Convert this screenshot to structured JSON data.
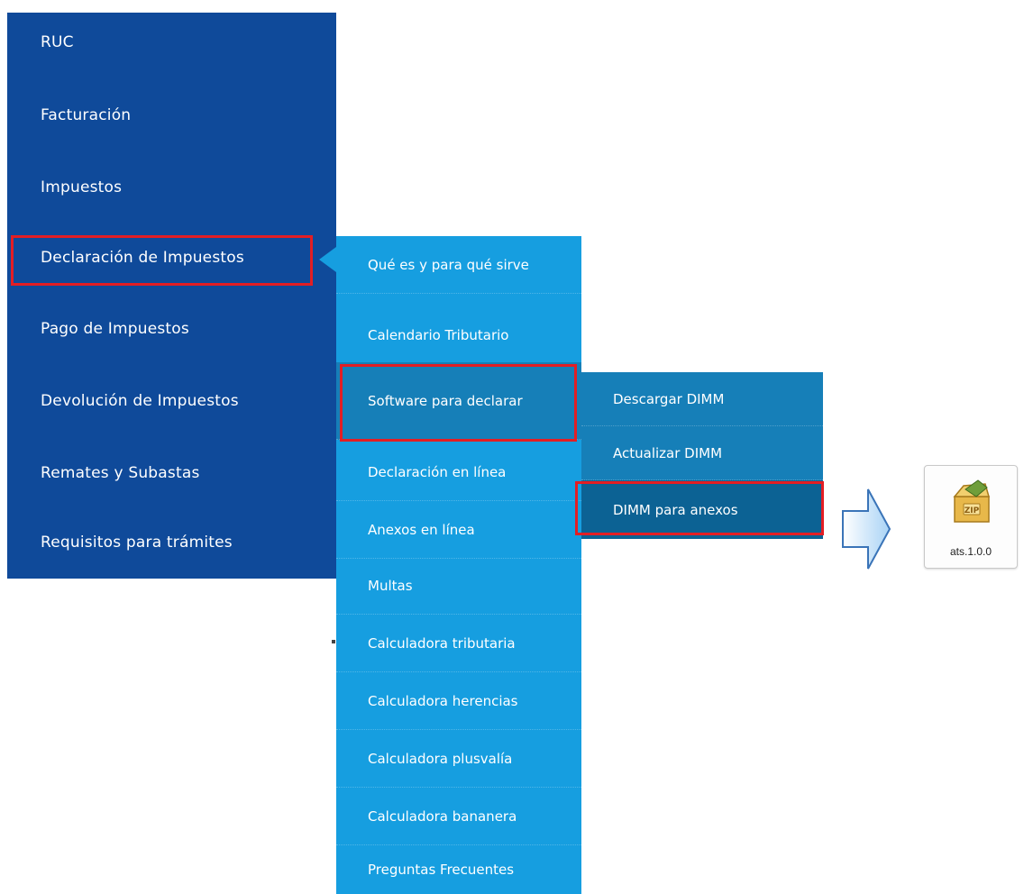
{
  "main_menu": {
    "items": [
      {
        "label": "RUC"
      },
      {
        "label": "Facturación"
      },
      {
        "label": "Impuestos"
      },
      {
        "label": "Declaración de Impuestos"
      },
      {
        "label": "Pago de Impuestos"
      },
      {
        "label": "Devolución de Impuestos"
      },
      {
        "label": "Remates y Subastas"
      },
      {
        "label": "Requisitos para trámites"
      }
    ]
  },
  "sub_menu": {
    "items": [
      {
        "label": "Qué es y para qué sirve"
      },
      {
        "label": "Calendario Tributario"
      },
      {
        "label": "Software para declarar"
      },
      {
        "label": "Declaración en línea"
      },
      {
        "label": "Anexos en línea"
      },
      {
        "label": "Multas"
      },
      {
        "label": "Calculadora tributaria"
      },
      {
        "label": "Calculadora herencias"
      },
      {
        "label": "Calculadora plusvalía"
      },
      {
        "label": "Calculadora bananera"
      },
      {
        "label": "Preguntas Frecuentes"
      }
    ]
  },
  "sub_menu_2": {
    "items": [
      {
        "label": "Descargar DIMM"
      },
      {
        "label": "Actualizar DIMM"
      },
      {
        "label": "DIMM para anexos"
      }
    ]
  },
  "download": {
    "file_label": "ats.1.0.0",
    "icon": "zip-archive-icon"
  },
  "colors": {
    "main_menu_bg": "#0f4a9a",
    "sub_menu_bg": "#169ee0",
    "sub_menu_2_bg": "#167fb8",
    "highlight": "#e31e24"
  }
}
